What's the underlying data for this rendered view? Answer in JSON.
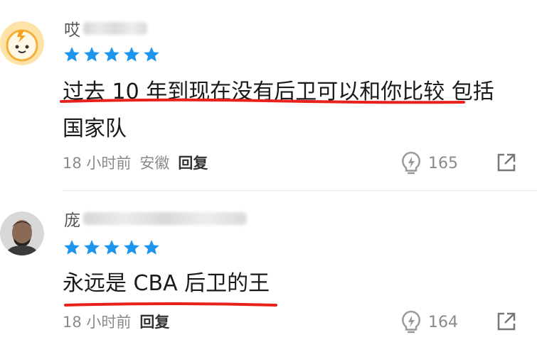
{
  "comments": [
    {
      "username_visible": "哎",
      "rating_stars": 5,
      "text_line1": "过去 10 年到现在没有后卫可以和你比较 包括",
      "text_line2": "国家队",
      "time": "18 小时前",
      "location": "安徽",
      "reply_label": "回复",
      "likes": "165"
    },
    {
      "username_visible": "庞",
      "rating_stars": 5,
      "text_line1": "永远是 CBA 后卫的王",
      "time": "18 小时前",
      "reply_label": "回复",
      "likes": "164"
    }
  ],
  "colors": {
    "star": "#1e96f0",
    "underline": "#e8211c",
    "avatar1_bg": "#fde3a7"
  },
  "icons": [
    "lightbulb-like-icon",
    "share-icon",
    "star-icon"
  ]
}
